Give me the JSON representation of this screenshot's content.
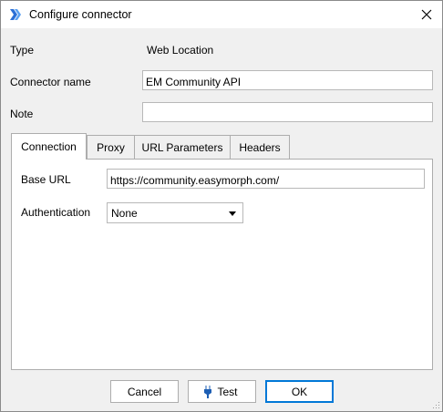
{
  "window": {
    "title": "Configure connector"
  },
  "form": {
    "type_label": "Type",
    "type_value": "Web Location",
    "name_label": "Connector name",
    "name_value": "EM Community API",
    "note_label": "Note",
    "note_value": ""
  },
  "tabs": [
    {
      "label": "Connection",
      "active": true
    },
    {
      "label": "Proxy",
      "active": false
    },
    {
      "label": "URL Parameters",
      "active": false
    },
    {
      "label": "Headers",
      "active": false
    }
  ],
  "connection": {
    "base_url_label": "Base URL",
    "base_url_value": "https://community.easymorph.com/",
    "auth_label": "Authentication",
    "auth_value": "None"
  },
  "buttons": {
    "cancel": "Cancel",
    "test": "Test",
    "ok": "OK"
  },
  "colors": {
    "accent": "#0078d7",
    "dialog_bg": "#f0f0f0",
    "panel_bg": "#ffffff"
  }
}
